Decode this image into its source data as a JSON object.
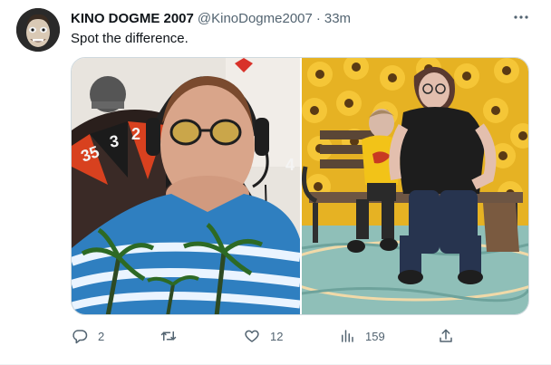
{
  "tweet": {
    "author": {
      "display_name": "KINO DOGME 2007",
      "handle": "@KinoDogme2007",
      "separator": "·",
      "time": "33m"
    },
    "text": "Spot the difference.",
    "media": [
      {
        "name": "left-photo",
        "roulette_numbers": [
          "35",
          "3",
          "2",
          "4"
        ]
      },
      {
        "name": "right-photo"
      }
    ],
    "actions": {
      "replies": "2",
      "retweets": "",
      "likes": "12",
      "views": "159"
    }
  },
  "colors": {
    "text_primary": "#0f1419",
    "text_secondary": "#536471",
    "border": "#cfd9de",
    "divider": "#eff3f4"
  },
  "icons": [
    "avatar",
    "more-icon",
    "reply-icon",
    "retweet-icon",
    "like-icon",
    "views-icon",
    "share-icon"
  ]
}
